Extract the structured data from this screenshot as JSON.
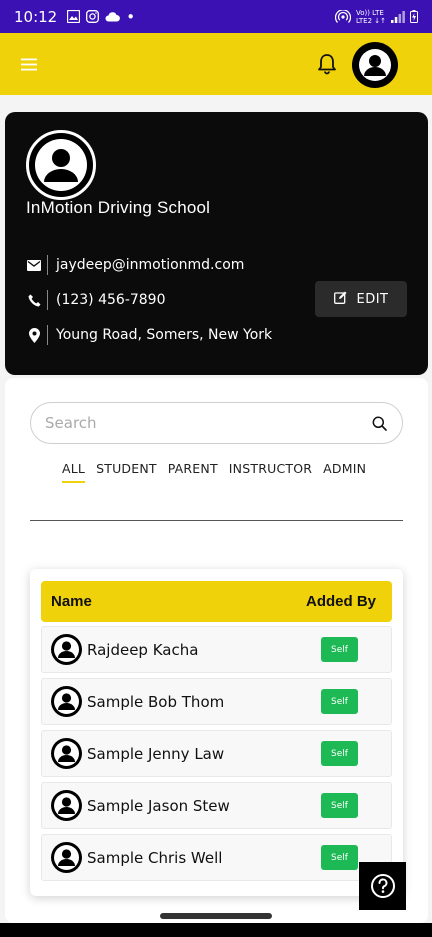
{
  "status_bar": {
    "time": "10:12",
    "dot": "•",
    "lte_top": "Vo)) LTE",
    "lte_bottom": "LTE2 ↓↑"
  },
  "app_bar": {
    "menu_icon": "hamburger-menu-icon",
    "bell_icon": "bell-icon",
    "avatar_icon": "user-avatar-icon",
    "accent_color": "#f0d20a"
  },
  "profile": {
    "name": "InMotion Driving School",
    "email": "jaydeep@inmotionmd.com",
    "phone": "(123) 456-7890",
    "address": "Young Road, Somers, New York",
    "edit_label": "EDIT"
  },
  "search": {
    "placeholder": "Search"
  },
  "tabs": [
    {
      "label": "ALL",
      "active": true
    },
    {
      "label": "STUDENT",
      "active": false
    },
    {
      "label": "PARENT",
      "active": false
    },
    {
      "label": "INSTRUCTOR",
      "active": false
    },
    {
      "label": "ADMIN",
      "active": false
    }
  ],
  "table": {
    "headers": {
      "name": "Name",
      "added_by": "Added By"
    },
    "rows": [
      {
        "name": "Rajdeep Kacha",
        "added_by": "Self"
      },
      {
        "name": "Sample Bob Thom",
        "added_by": "Self"
      },
      {
        "name": "Sample Jenny Law",
        "added_by": "Self"
      },
      {
        "name": "Sample Jason Stew",
        "added_by": "Self"
      },
      {
        "name": "Sample Chris Well",
        "added_by": "Self"
      }
    ],
    "badge_color": "#1db954"
  },
  "help": {
    "icon": "help-circle-icon"
  }
}
